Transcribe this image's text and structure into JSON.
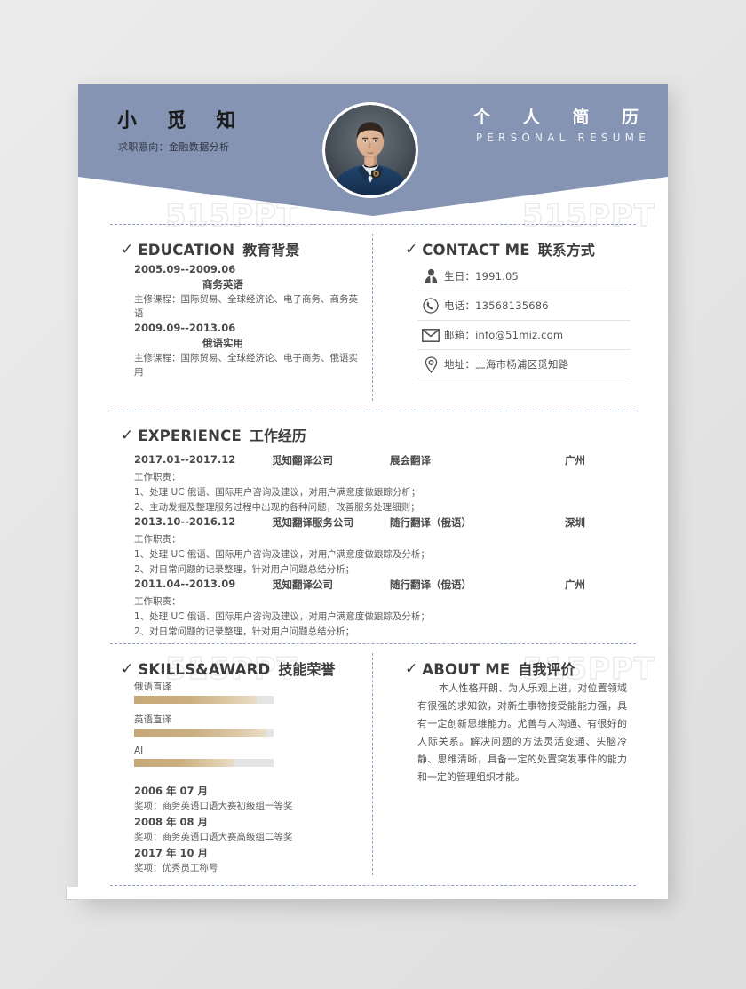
{
  "header": {
    "name": "小 觅 知",
    "objective": "求职意向：金融数据分析",
    "title_cn": "个 人 简 历",
    "title_en": "PERSONAL RESUME",
    "photo_alt": "portrait-photo",
    "bg_color": "#8694b4"
  },
  "watermark": {
    "text": "515PPT"
  },
  "education": {
    "heading_en": "EDUCATION",
    "heading_cn": "教育背景",
    "items": [
      {
        "date": "2005.09--2009.06",
        "major": "商务英语",
        "desc": "主修课程：国际贸易、全球经济论、电子商务、商务英语"
      },
      {
        "date": "2009.09--2013.06",
        "major": "俄语实用",
        "desc": "主修课程：国际贸易、全球经济论、电子商务、俄语实用"
      }
    ]
  },
  "contact": {
    "heading_en": "CONTACT ME",
    "heading_cn": "联系方式",
    "items": [
      {
        "icon": "person-icon",
        "text": "生日：1991.05"
      },
      {
        "icon": "phone-icon",
        "text": "电话：13568135686"
      },
      {
        "icon": "envelope-icon",
        "text": "邮箱：info@51miz.com"
      },
      {
        "icon": "location-icon",
        "text": "地址：上海市杨浦区觅知路"
      }
    ]
  },
  "experience": {
    "heading_en": "EXPERIENCE",
    "heading_cn": "工作经历",
    "items": [
      {
        "date": "2017.01--2017.12",
        "company": "觅知翻译公司",
        "role": "展会翻译",
        "city": "广州",
        "duty_label": "工作职责：",
        "duties": [
          "1、处理 UC 俄语、国际用户咨询及建议，对用户满意度做跟踪分析；",
          "2、主动发掘及整理服务过程中出现的各种问题，改善服务处理细则；"
        ]
      },
      {
        "date": "2013.10--2016.12",
        "company": "觅知翻译服务公司",
        "role": "随行翻译（俄语）",
        "city": "深圳",
        "duty_label": "工作职责：",
        "duties": [
          "1、处理 UC 俄语、国际用户咨询及建议，对用户满意度做跟踪及分析；",
          "2、对日常问题的记录整理，针对用户问题总结分析；"
        ]
      },
      {
        "date": "2011.04--2013.09",
        "company": "觅知翻译公司",
        "role": "随行翻译（俄语）",
        "city": "广州",
        "duty_label": "工作职责：",
        "duties": [
          "1、处理 UC 俄语、国际用户咨询及建议，对用户满意度做跟踪及分析；",
          "2、对日常问题的记录整理，针对用户问题总结分析；"
        ]
      }
    ]
  },
  "skills": {
    "heading_en": "SKILLS&AWARD",
    "heading_cn": "技能荣誉",
    "bars": [
      {
        "label": "俄语直译",
        "percent": 88
      },
      {
        "label": "英语直译",
        "percent": 95
      },
      {
        "label": "AI",
        "percent": 72
      }
    ],
    "bar_color": "#c8aa7a",
    "awards": [
      {
        "date": "2006 年 07 月",
        "text": "奖项：商务英语口语大赛初级组一等奖"
      },
      {
        "date": "2008 年 08 月",
        "text": "奖项：商务英语口语大赛高级组二等奖"
      },
      {
        "date": "2017 年 10 月",
        "text": "奖项：优秀员工称号"
      }
    ]
  },
  "about": {
    "heading_en": "ABOUT ME",
    "heading_cn": "自我评价",
    "text": "本人性格开朗、为人乐观上进，对位置领域有很强的求知欲，对新生事物接受能能力强，具有一定创新思维能力。尤善与人沟通、有很好的人际关系。解决问题的方法灵活变通、头脑冷静、思维清晰，具备一定的处置突发事件的能力和一定的管理组织才能。"
  }
}
